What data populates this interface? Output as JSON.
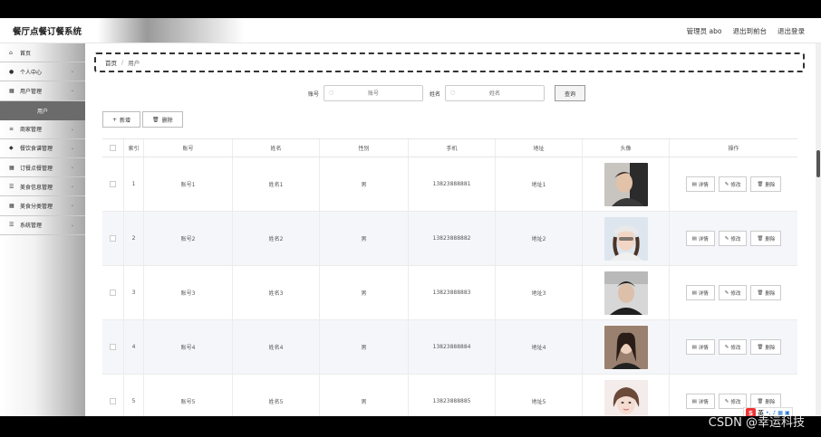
{
  "header": {
    "title": "餐厅点餐订餐系统",
    "user": "管理员 abo",
    "back_front": "退出到前台",
    "logout": "退出登录"
  },
  "sidebar": {
    "items": [
      {
        "label": "首页",
        "icon": "home-icon",
        "glyph": "⌂",
        "chevron": false
      },
      {
        "label": "个人中心",
        "icon": "user-icon",
        "glyph": "●",
        "chevron": true
      },
      {
        "label": "用户管理",
        "icon": "grid-icon",
        "glyph": "▦",
        "chevron": true
      },
      {
        "label": "商家管理",
        "icon": "sliders-icon",
        "glyph": "≡",
        "chevron": true
      },
      {
        "label": "餐饮食谱管理",
        "icon": "shop-icon",
        "glyph": "◆",
        "chevron": true
      },
      {
        "label": "订餐点餐管理",
        "icon": "grid-icon",
        "glyph": "▦",
        "chevron": true
      },
      {
        "label": "美食信息管理",
        "icon": "list-icon",
        "glyph": "☰",
        "chevron": true
      },
      {
        "label": "美食分类管理",
        "icon": "grid-icon",
        "glyph": "▦",
        "chevron": true
      },
      {
        "label": "系统管理",
        "icon": "list-icon",
        "glyph": "☰",
        "chevron": true
      }
    ],
    "active_sub": "用户"
  },
  "breadcrumb": {
    "home": "首页",
    "sep": "/",
    "current": "用户"
  },
  "search": {
    "account_label": "账号",
    "account_placeholder": "账号",
    "name_label": "姓名",
    "name_placeholder": "姓名",
    "button": "查询"
  },
  "actions": {
    "add": "新增",
    "delete": "删除"
  },
  "table": {
    "headers": [
      "",
      "索引",
      "账号",
      "姓名",
      "性别",
      "手机",
      "地址",
      "头像",
      "操作"
    ],
    "ops": {
      "detail": "详情",
      "edit": "修改",
      "delete": "删除"
    },
    "rows": [
      {
        "idx": "1",
        "account": "账号1",
        "name": "姓名1",
        "sex": "男",
        "phone": "13823888881",
        "addr": "地址1"
      },
      {
        "idx": "2",
        "account": "账号2",
        "name": "姓名2",
        "sex": "男",
        "phone": "13823888882",
        "addr": "地址2"
      },
      {
        "idx": "3",
        "account": "账号3",
        "name": "姓名3",
        "sex": "男",
        "phone": "13823888883",
        "addr": "地址3"
      },
      {
        "idx": "4",
        "account": "账号4",
        "name": "姓名4",
        "sex": "男",
        "phone": "13823888884",
        "addr": "地址4"
      },
      {
        "idx": "5",
        "account": "账号5",
        "name": "姓名5",
        "sex": "男",
        "phone": "13823888885",
        "addr": "地址5"
      }
    ]
  },
  "watermark": "CSDN @幸运科技",
  "ime": {
    "logo": "S",
    "text": "英"
  },
  "colors": {
    "sidebar_active": "#6b6b6b",
    "alt_row": "#f5f6fa"
  }
}
